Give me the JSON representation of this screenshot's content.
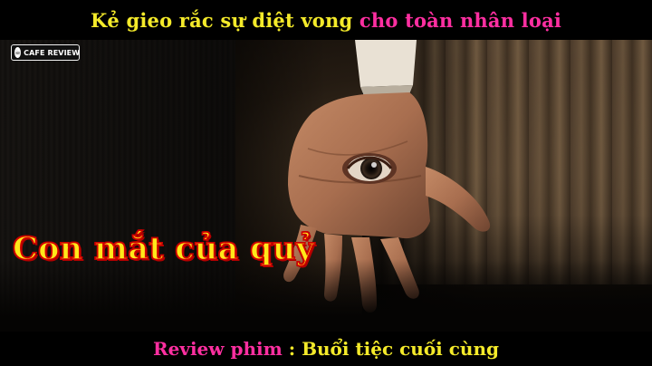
{
  "header": {
    "title_part1": "Kẻ gieo rắc sự diệt vong",
    "title_part2": "cho toàn nhân loại"
  },
  "logo": {
    "icon": "coffee-cup-icon",
    "text": "CAFE REVIEW"
  },
  "overlay": {
    "title": "Con mắt của quỷ"
  },
  "footer": {
    "lead": "Review phim",
    "separator": ":",
    "film_title": "Buổi tiệc cuối cùng"
  },
  "colors": {
    "yellow": "#f4ea2a",
    "pink": "#ff2fa1",
    "outline_red": "#d10000",
    "bar_black": "#000000"
  }
}
